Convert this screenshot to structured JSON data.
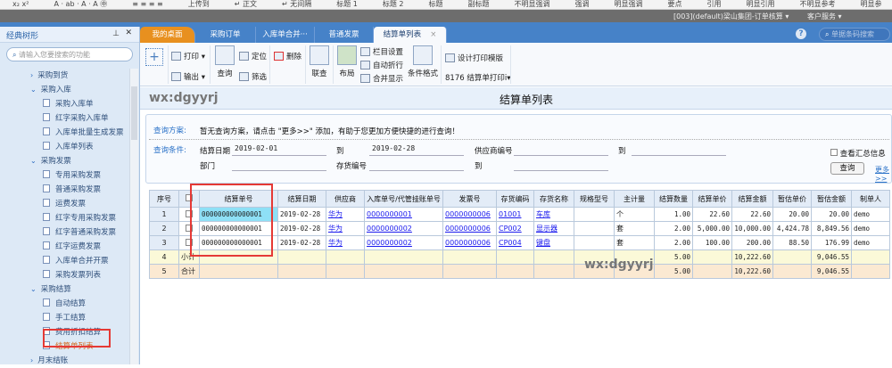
{
  "ribbon": {
    "items": [
      "x₂ x²",
      "A · ab · A · A ㊥",
      "≡ ≡ ≡ ≡",
      "上传到",
      "↵ 正文",
      "↵ 无间隔",
      "标题 1",
      "标题 2",
      "标题",
      "副标题",
      "不明显强调",
      "强调",
      "明显强调",
      "要点",
      "引用",
      "明显引用",
      "不明显参考",
      "明显参"
    ]
  },
  "sysbar": {
    "company": "[003](default)梁山集团-订单核算 ▾",
    "service": "客户服务 ▾"
  },
  "sidebar": {
    "title": "经典树形",
    "search_placeholder": "请输入您要搜索的功能",
    "items": [
      {
        "label": "采购到货",
        "level": 1,
        "expanded": false
      },
      {
        "label": "采购入库",
        "level": 1,
        "expanded": true
      },
      {
        "label": "采购入库单",
        "level": 2
      },
      {
        "label": "红字采购入库单",
        "level": 2
      },
      {
        "label": "入库单批量生成发票",
        "level": 2
      },
      {
        "label": "入库单列表",
        "level": 2
      },
      {
        "label": "采购发票",
        "level": 1,
        "expanded": true
      },
      {
        "label": "专用采购发票",
        "level": 2
      },
      {
        "label": "普通采购发票",
        "level": 2
      },
      {
        "label": "运费发票",
        "level": 2
      },
      {
        "label": "红字专用采购发票",
        "level": 2
      },
      {
        "label": "红字普通采购发票",
        "level": 2
      },
      {
        "label": "红字运费发票",
        "level": 2
      },
      {
        "label": "入库单合并开票",
        "level": 2
      },
      {
        "label": "采购发票列表",
        "level": 2
      },
      {
        "label": "采购结算",
        "level": 1,
        "expanded": true
      },
      {
        "label": "自动结算",
        "level": 2
      },
      {
        "label": "手工结算",
        "level": 2
      },
      {
        "label": "费用折扣结算",
        "level": 2
      },
      {
        "label": "结算单列表",
        "level": 2,
        "active": true
      },
      {
        "label": "月末结账",
        "level": 1,
        "expanded": false
      }
    ]
  },
  "tabs": [
    {
      "label": "我的桌面"
    },
    {
      "label": "采购订单"
    },
    {
      "label": "入库单合并···"
    },
    {
      "label": "普通发票"
    },
    {
      "label": "结算单列表",
      "active": true
    }
  ],
  "header_search_placeholder": "单据条码搜索",
  "toolbar": {
    "print": "打印",
    "export": "输出",
    "query": "查询",
    "locate": "定位",
    "filter": "筛选",
    "delete": "删除",
    "link": "联查",
    "layout": "布局",
    "column_settings": "栏目设置",
    "auto_wrap": "自动折行",
    "merge_display": "合并显示",
    "conditional_format": "条件格式",
    "design_template": "设计打印模版",
    "print_template": "8176 结算单打印i▾"
  },
  "page": {
    "title": "结算单列表",
    "watermark": "wx:dgyyrj"
  },
  "query": {
    "scheme_label": "查询方案:",
    "scheme_text": "暂无查询方案，请点击 \"更多>>\" 添加，有助于您更加方便快捷的进行查询！",
    "cond_label": "查询条件:",
    "date_label": "结算日期",
    "date_from": "2019-02-01",
    "to1": "到",
    "date_to": "2019-02-28",
    "supplier_label": "供应商编号",
    "to2": "到",
    "dept_label": "部门",
    "inv_label": "存货编号",
    "to3": "到",
    "summary_label": "查看汇总信息",
    "query_button": "查询",
    "more_link": "更多>>"
  },
  "table": {
    "columns": [
      "序号",
      "",
      "结算单号",
      "结算日期",
      "供应商",
      "入库单号/代管挂账单号",
      "发票号",
      "存货编码",
      "存货名称",
      "规格型号",
      "主计量",
      "结算数量",
      "结算单价",
      "结算金额",
      "暂估单价",
      "暂估金额",
      "制单人"
    ],
    "rows": [
      {
        "idx": "1",
        "no": "000000000000001",
        "date": "2019-02-28",
        "supplier": "华为",
        "receipt": "0000000001",
        "invoice": "0000000006",
        "code": "01001",
        "name": "车库",
        "spec": "",
        "unit": "个",
        "qty": "1.00",
        "price": "22.60",
        "amount": "22.60",
        "est_price": "20.00",
        "est_amount": "20.00",
        "maker": "demo"
      },
      {
        "idx": "2",
        "no": "000000000000001",
        "date": "2019-02-28",
        "supplier": "华为",
        "receipt": "0000000002",
        "invoice": "0000000006",
        "code": "CP002",
        "name": "显示器",
        "spec": "",
        "unit": "套",
        "qty": "2.00",
        "price": "5,000.00",
        "amount": "10,000.00",
        "est_price": "4,424.78",
        "est_amount": "8,849.56",
        "maker": "demo"
      },
      {
        "idx": "3",
        "no": "000000000000001",
        "date": "2019-02-28",
        "supplier": "华为",
        "receipt": "0000000002",
        "invoice": "0000000006",
        "code": "CP004",
        "name": "键盘",
        "spec": "",
        "unit": "套",
        "qty": "2.00",
        "price": "100.00",
        "amount": "200.00",
        "est_price": "88.50",
        "est_amount": "176.99",
        "maker": "demo"
      }
    ],
    "subtotal": {
      "idx": "4",
      "label": "小计",
      "qty": "5.00",
      "amount": "10,222.60",
      "est_amount": "9,046.55"
    },
    "total": {
      "idx": "5",
      "label": "合计",
      "qty": "5.00",
      "amount": "10,222.60",
      "est_amount": "9,046.55"
    }
  }
}
